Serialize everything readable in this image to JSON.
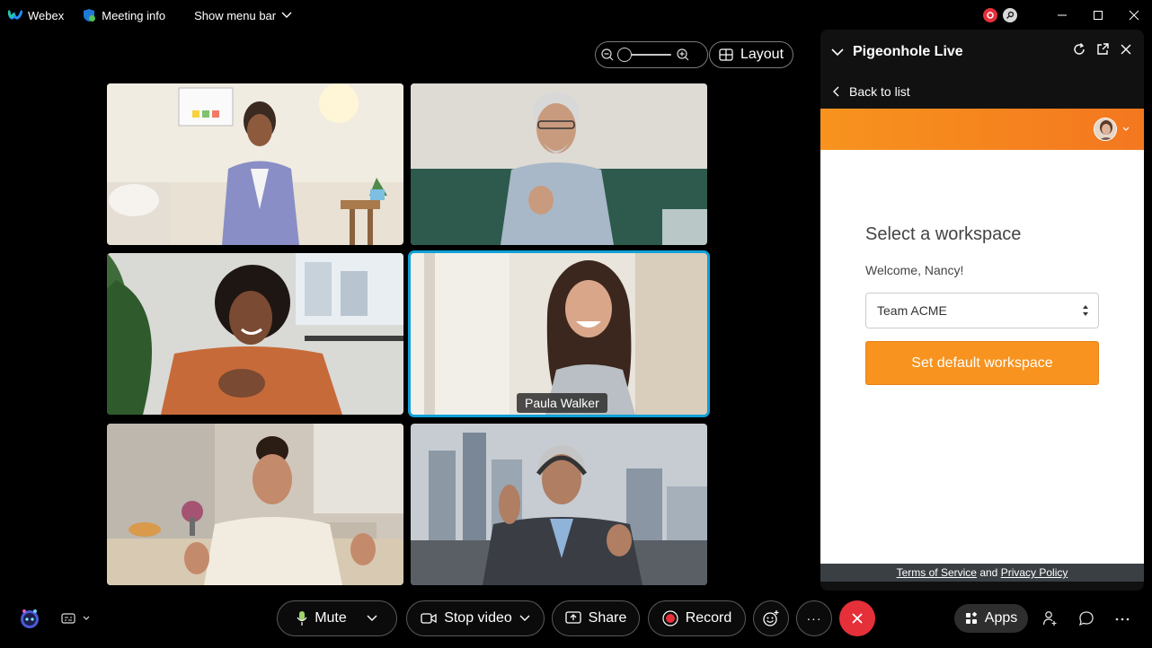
{
  "titlebar": {
    "app_name": "Webex",
    "meeting_info": "Meeting info",
    "menu_bar": "Show menu bar"
  },
  "layout": {
    "label": "Layout"
  },
  "participants": [
    {
      "tile": "tile-1",
      "name": ""
    },
    {
      "tile": "tile-2",
      "name": ""
    },
    {
      "tile": "tile-3",
      "name": ""
    },
    {
      "tile": "tile-4",
      "name": "Paula Walker",
      "active": true
    },
    {
      "tile": "tile-5",
      "name": ""
    },
    {
      "tile": "tile-6",
      "name": ""
    }
  ],
  "panel": {
    "title": "Pigeonhole Live",
    "back": "Back to list",
    "workspace_title": "Select a workspace",
    "welcome": "Welcome, Nancy!",
    "workspace_value": "Team ACME",
    "default_button": "Set default workspace",
    "footer": {
      "terms": "Terms of Service",
      "and": "and",
      "privacy": "Privacy Policy"
    },
    "accent": "#f7931e"
  },
  "toolbar": {
    "mute": "Mute",
    "stop_video": "Stop video",
    "share": "Share",
    "record": "Record",
    "apps": "Apps",
    "more": "···"
  },
  "colors": {
    "active_speaker": "#0fa0d6",
    "end_call": "#e5303a",
    "record_dot": "#e5303a"
  }
}
